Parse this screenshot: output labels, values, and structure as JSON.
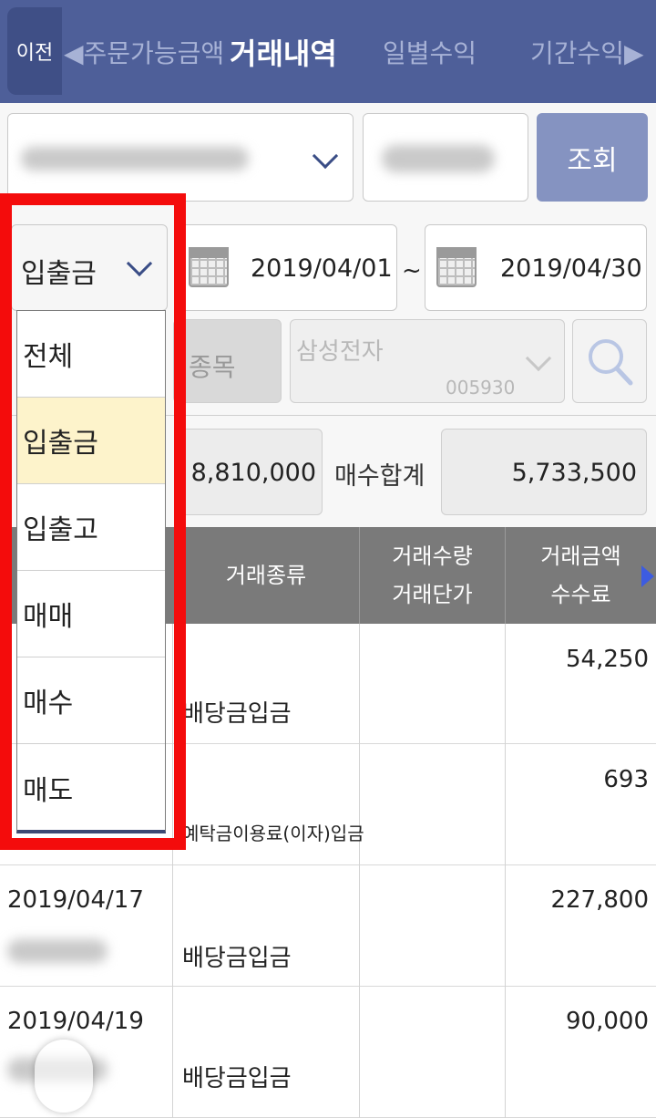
{
  "header": {
    "back": "이전",
    "tabs": [
      "◀주문가능금액",
      "거래내역",
      "일별수익",
      "기간수익▶"
    ]
  },
  "account": {
    "query_button": "조회"
  },
  "filter": {
    "type_selected": "입출금",
    "date_from": "2019/04/01",
    "tilde": "~",
    "date_to": "2019/04/30"
  },
  "stock": {
    "label": "종목",
    "name": "삼성전자",
    "code": "005930"
  },
  "summary": {
    "value1": "8,810,000",
    "buy_total_label": "매수합계",
    "buy_total_value": "5,733,500"
  },
  "table": {
    "headers": {
      "type": "거래종류",
      "qty": "거래수량",
      "price": "거래단가",
      "amount": "거래금액",
      "fee": "수수료"
    },
    "rows": [
      {
        "date": "",
        "type": "배당금입금",
        "amount": "54,250"
      },
      {
        "date": "",
        "type": "예탁금이용료(이자)입금",
        "amount": "693"
      },
      {
        "date": "2019/04/17",
        "type": "배당금입금",
        "amount": "227,800"
      },
      {
        "date": "2019/04/19",
        "type": "배당금입금",
        "amount": "90,000"
      }
    ]
  },
  "dropdown": {
    "options": [
      "전체",
      "입출금",
      "입출고",
      "매매",
      "매수",
      "매도"
    ],
    "selected_index": 1
  },
  "colors": {
    "header": "#4e5f99",
    "highlight": "#f40c0c",
    "selected_option": "#fdf3cb"
  }
}
